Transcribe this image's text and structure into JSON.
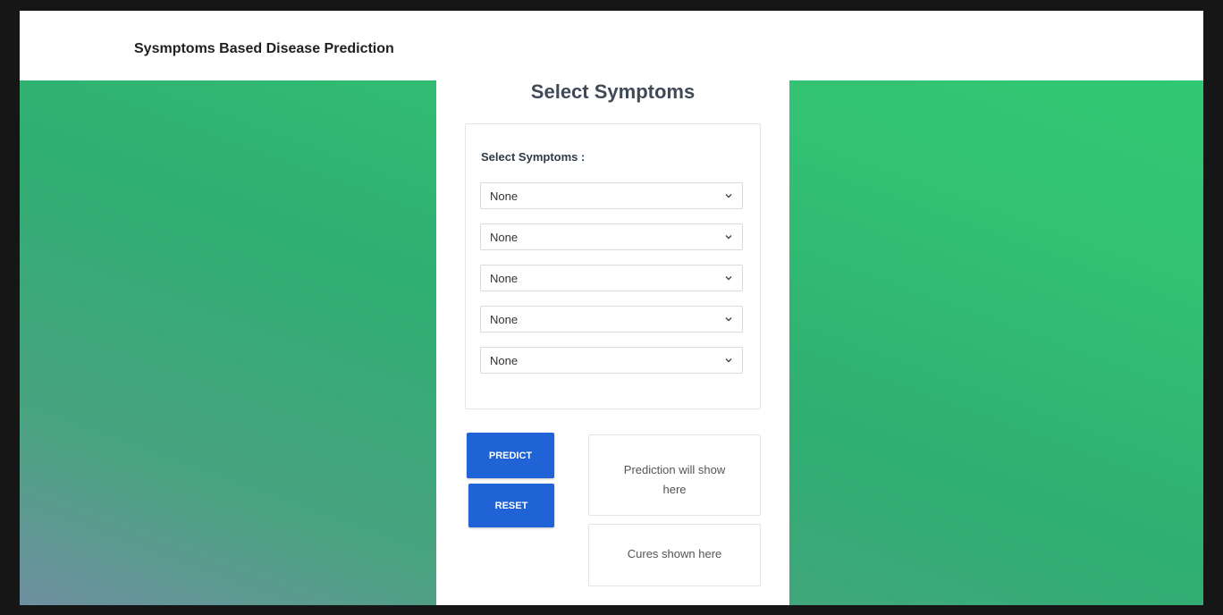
{
  "header": {
    "app_title": "Sysmptoms Based Disease Prediction"
  },
  "panel": {
    "title": "Select Symptoms",
    "symptom_label": "Select Symptoms :",
    "selects": [
      {
        "value": "None"
      },
      {
        "value": "None"
      },
      {
        "value": "None"
      },
      {
        "value": "None"
      },
      {
        "value": "None"
      }
    ],
    "predict_label": "PREDICT",
    "reset_label": "RESET",
    "prediction_placeholder": "Prediction will show here",
    "cures_placeholder": "Cures shown here"
  },
  "colors": {
    "button": "#1f63d6",
    "background_green": "#2fae72",
    "background_slate": "#6f8fa0"
  }
}
